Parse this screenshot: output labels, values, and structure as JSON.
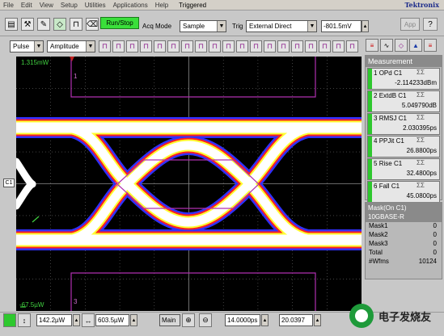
{
  "menu": {
    "items": [
      "File",
      "Edit",
      "View",
      "Setup",
      "Utilities",
      "Applications",
      "Help"
    ],
    "trigger_status": "Triggered",
    "brand": "Tektronix"
  },
  "toolbar": {
    "run_stop": "Run/Stop",
    "acq_mode_label": "Acq Mode",
    "acq_mode_value": "Sample",
    "trig_label": "Trig",
    "trig_value": "External Direct",
    "trig_level": "-801.5mV",
    "app_button": "App",
    "help_button": "?",
    "meas_type": "Pulse",
    "meas_param": "Amplitude"
  },
  "scope": {
    "top_readout": "1.315mW",
    "bottom_readout": "-67.5µW",
    "channel_label": "C1",
    "mask_region_labels": [
      "1",
      "2",
      "3"
    ],
    "trace_color": "#ffffff",
    "mask_color": "#b030b0"
  },
  "measurements": {
    "title": "Measurement",
    "items": [
      {
        "index": "1",
        "name": "OPd",
        "source": "C1",
        "value": "-2.114233dBm"
      },
      {
        "index": "2",
        "name": "ExtdB",
        "source": "C1",
        "value": "5.049790dB"
      },
      {
        "index": "3",
        "name": "RMSJ",
        "source": "C1",
        "value": "2.030395ps"
      },
      {
        "index": "4",
        "name": "PPJit",
        "source": "C1",
        "value": "26.8800ps"
      },
      {
        "index": "5",
        "name": "Rise",
        "source": "C1",
        "value": "32.4800ps"
      },
      {
        "index": "6",
        "name": "Fall",
        "source": "C1",
        "value": "45.0800ps"
      }
    ]
  },
  "mask": {
    "title": "Mask(On C1)",
    "standard": "10GBASE-R",
    "rows": [
      {
        "label": "Mask1",
        "value": "0"
      },
      {
        "label": "Mask2",
        "value": "0"
      },
      {
        "label": "Mask3",
        "value": "0"
      },
      {
        "label": "Total",
        "value": "0"
      },
      {
        "label": "#Wfms",
        "value": "10124"
      }
    ]
  },
  "bottom": {
    "vert_scale": "142.2µW",
    "offset": "603.5µW",
    "timebase_label": "Main",
    "horiz_scale": "14.0000ps",
    "position": "20.0397",
    "watermark": "电子发烧友"
  }
}
